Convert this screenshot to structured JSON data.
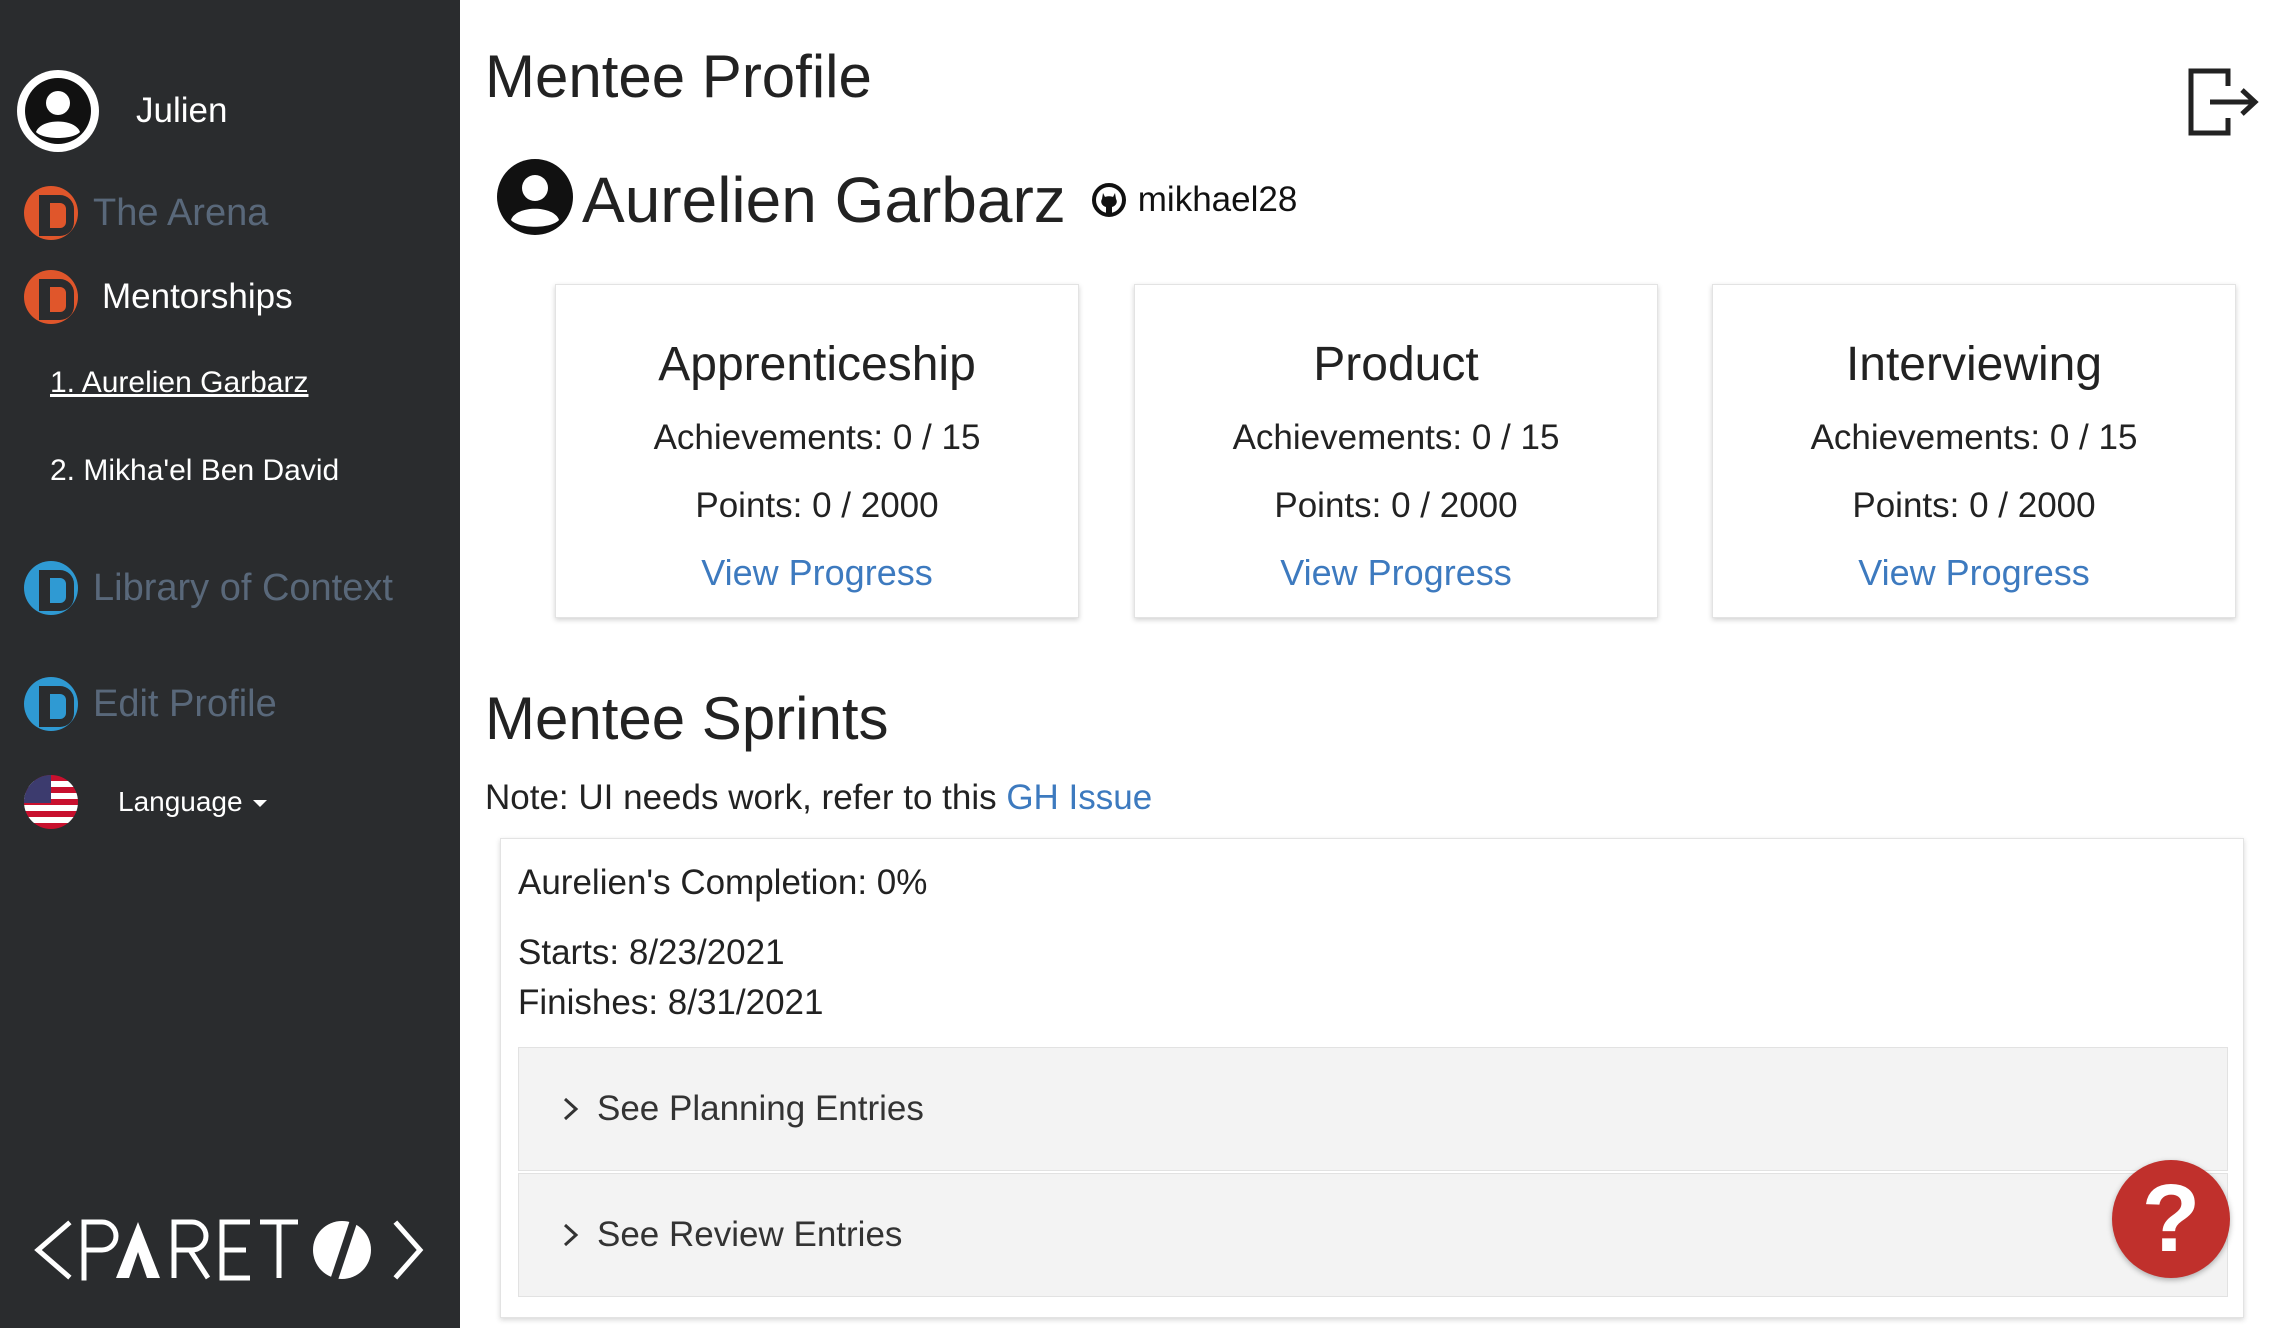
{
  "sidebar": {
    "user_name": "Julien",
    "items": [
      {
        "label": "The Arena",
        "icon": "pareto-orange-icon"
      },
      {
        "label": "Mentorships",
        "icon": "pareto-orange-icon"
      },
      {
        "label": "Library of Context",
        "icon": "pareto-blue-icon"
      },
      {
        "label": "Edit Profile",
        "icon": "pareto-blue-icon"
      }
    ],
    "mentees": [
      "1. Aurelien Garbarz",
      "2. Mikha'el Ben David"
    ],
    "language_label": "Language",
    "logo_text": "PARETO",
    "colors": {
      "background": "#2a2c2e",
      "orange": "#e0562b",
      "blue": "#2f9ad3",
      "muted_text": "#59687a"
    }
  },
  "main": {
    "page_title": "Mentee Profile",
    "profile": {
      "name": "Aurelien Garbarz",
      "github_username": "mikhael28"
    },
    "cards": [
      {
        "title": "Apprenticeship",
        "achievements": "Achievements: 0 / 15",
        "points": "Points: 0 / 2000",
        "link": "View Progress"
      },
      {
        "title": "Product",
        "achievements": "Achievements: 0 / 15",
        "points": "Points: 0 / 2000",
        "link": "View Progress"
      },
      {
        "title": "Interviewing",
        "achievements": "Achievements: 0 / 15",
        "points": "Points: 0 / 2000",
        "link": "View Progress"
      }
    ],
    "sprints_title": "Mentee Sprints",
    "note_text": "Note: UI needs work, refer to this ",
    "note_link": "GH Issue",
    "sprint": {
      "completion": "Aurelien's Completion: 0%",
      "starts": "Starts: 8/23/2021",
      "finishes": "Finishes: 8/31/2021",
      "accordions": [
        "See Planning Entries",
        "See Review Entries"
      ]
    },
    "help_label": "?",
    "colors": {
      "link": "#3d7abf",
      "help": "#c0302c"
    }
  }
}
